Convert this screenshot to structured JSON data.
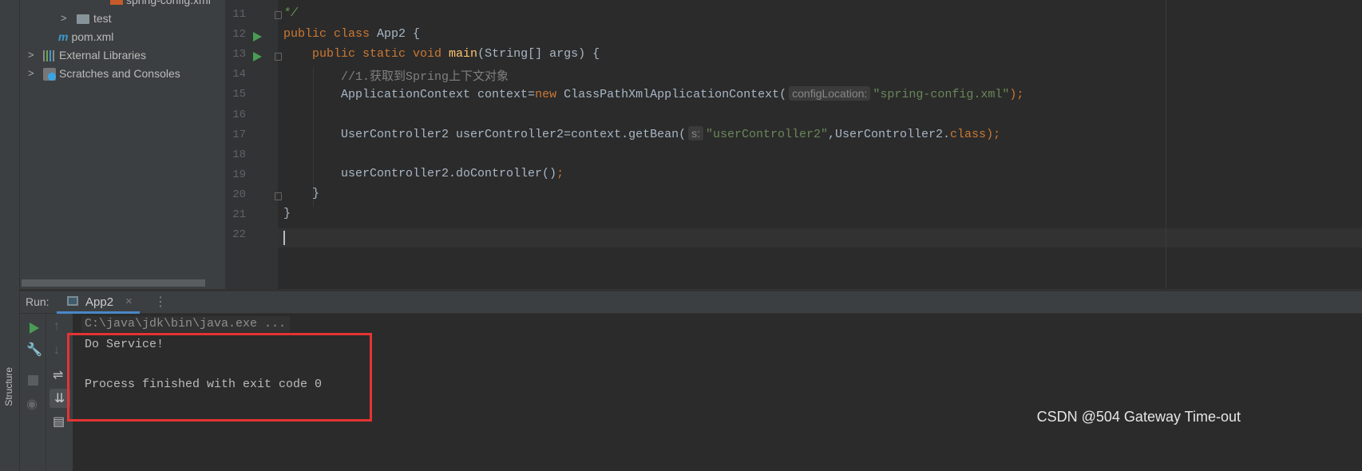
{
  "project_tree": [
    {
      "label": "spring-config.xml",
      "icon": "xml-file-icon"
    },
    {
      "label": "test",
      "icon": "folder-icon"
    },
    {
      "label": "pom.xml",
      "icon": "maven-icon"
    },
    {
      "label": "External Libraries",
      "icon": "libraries-icon"
    },
    {
      "label": "Scratches and Consoles",
      "icon": "scratches-icon"
    }
  ],
  "side_tab": "Structure",
  "editor": {
    "line_numbers": [
      "11",
      "12",
      "13",
      "14",
      "15",
      "16",
      "17",
      "18",
      "19",
      "20",
      "21",
      "22"
    ],
    "lines": {
      "l11": "*/",
      "l12a": "public class ",
      "l12b": "App2 {",
      "l13a": "public static void ",
      "l13b": "main",
      "l13c": "(String[] args) {",
      "l14": "//1.获取到Spring上下文对象",
      "l15a": "ApplicationContext context=",
      "l15b": "new ",
      "l15c": "ClassPathXmlApplicationContext(",
      "l15hint": "configLocation:",
      "l15d": "\"spring-config.xml\"",
      "l15e": ");",
      "l17a": "UserController2 userController2=context.getBean(",
      "l17hint": "s:",
      "l17b": "\"userController2\"",
      "l17c": ",UserController2.",
      "l17d": "class",
      "l17e": ");",
      "l19a": "userController2.doController()",
      "l19b": ";",
      "l20": "}",
      "l21": "}"
    }
  },
  "run_panel": {
    "label": "Run:",
    "tab": "App2",
    "console": [
      "C:\\java\\jdk\\bin\\java.exe ...",
      "Do Service!",
      "",
      "Process finished with exit code 0"
    ]
  },
  "watermark": "CSDN @504 Gateway Time-out",
  "colors": {
    "highlight_box": "#e53333",
    "run_green": "#499c54"
  }
}
